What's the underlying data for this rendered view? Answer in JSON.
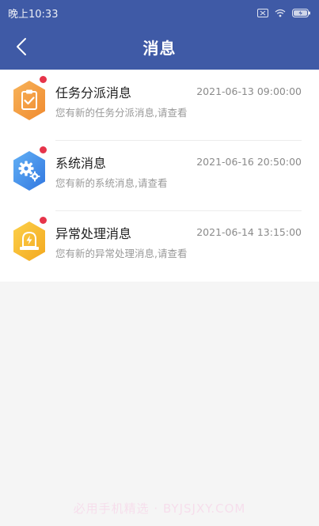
{
  "status_bar": {
    "time": "晚上10:33"
  },
  "header": {
    "title": "消息",
    "bg_color": "#3f5aa6"
  },
  "messages": [
    {
      "title": "任务分派消息",
      "time": "2021-06-13 09:00:00",
      "desc": "您有新的任务分派消息,请查看",
      "icon": "clipboard-check-icon",
      "unread": true
    },
    {
      "title": "系统消息",
      "time": "2021-06-16 20:50:00",
      "desc": "您有新的系统消息,请查看",
      "icon": "gears-icon",
      "unread": true
    },
    {
      "title": "异常处理消息",
      "time": "2021-06-14 13:15:00",
      "desc": "您有新的异常处理消息,请查看",
      "icon": "alert-lightning-icon",
      "unread": true
    }
  ],
  "colors": {
    "unread_dot": "#e6344a",
    "icon_orange": "#f39a3c",
    "icon_blue": "#3f8fe8",
    "icon_yellow": "#f5b82a"
  },
  "watermark": "必用手机精选 · BYJSJXY.COM"
}
